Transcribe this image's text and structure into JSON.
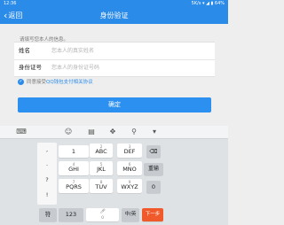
{
  "status_bar": {
    "time": "12:36",
    "right_info": "5K/s ▾ ◢ ▮ 64%"
  },
  "header": {
    "back_label": "返回",
    "title": "身份验证"
  },
  "form": {
    "hint": "请填写您本人的信息。",
    "name_label": "姓名",
    "name_placeholder": "您本人的真实姓名",
    "id_label": "身份证号",
    "id_placeholder": "您本人的身份证号码"
  },
  "agreement": {
    "prefix": "同意接受",
    "link": "QQ钱包支付相关协议",
    "checked": true
  },
  "confirm_label": "确定",
  "keyboard": {
    "toolbar": [
      "⌨",
      "☺",
      "▤",
      "✥",
      "⚲",
      "▾"
    ],
    "symbols": [
      ",",
      ".",
      "?",
      "!"
    ],
    "keys": {
      "k1": "1",
      "k2_num": "2",
      "k2": "ABC",
      "k3_num": "3",
      "k3": "DEF",
      "backspace": "⌫",
      "k4_num": "4",
      "k4": "GHI",
      "k5_num": "5",
      "k5": "JKL",
      "k6_num": "6",
      "k6": "MNO",
      "reenter": "重输",
      "k7_num": "7",
      "k7": "PQRS",
      "k8_num": "8",
      "k8": "TUV",
      "k9_num": "9",
      "k9": "WXYZ",
      "k0": "0",
      "sym": "符",
      "num": "123",
      "space_num": "0",
      "lang": "中/英",
      "next": "下一步"
    }
  },
  "colors": {
    "accent": "#2a8be8",
    "next_key": "#f05a2a"
  }
}
